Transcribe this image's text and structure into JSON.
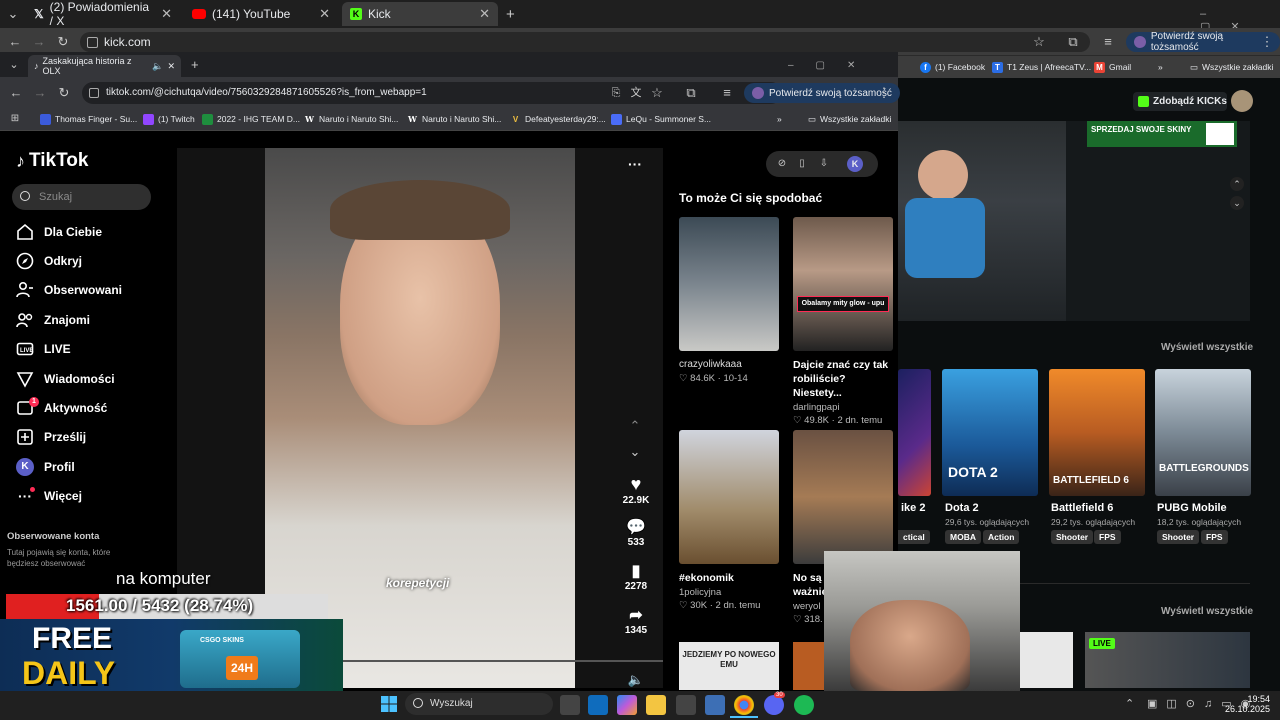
{
  "outer_browser": {
    "tabs": [
      {
        "label": "(2) Powiadomienia / X",
        "icon": "x-logo-icon"
      },
      {
        "label": "(141) YouTube",
        "icon": "youtube-icon"
      },
      {
        "label": "Kick",
        "icon": "kick-icon"
      }
    ],
    "url": "kick.com",
    "verify_label": "Potwierdź swoją tożsamość",
    "bookmarks": [
      "(1) Facebook",
      "T1 Zeus | AfreecaTV...",
      "Gmail"
    ],
    "all_bookmarks": "Wszystkie zakładki"
  },
  "inner_browser": {
    "tab_label": "Zaskakująca historia z OLX",
    "url": "tiktok.com/@cichutqa/video/7560329284871605526?is_from_webapp=1",
    "verify_label": "Potwierdź swoją tożsamość",
    "bookmarks": [
      {
        "label": "Thomas Finger - Su...",
        "color": "#3b5bdb"
      },
      {
        "label": "(1) Twitch",
        "color": "#9146ff"
      },
      {
        "label": "2022 - IHG TEAM D...",
        "color": "#1e8e3e"
      },
      {
        "label": "Naruto i Naruto Shi...",
        "icon": "W"
      },
      {
        "label": "Naruto i Naruto Shi...",
        "icon": "W"
      },
      {
        "label": "Defeatyesterday29:...",
        "icon": "V"
      },
      {
        "label": "LeQu - Summoner S...",
        "color": "#4a6cf7"
      }
    ],
    "all_bookmarks": "Wszystkie zakładki"
  },
  "tiktok": {
    "logo": "TikTok",
    "search_placeholder": "Szukaj",
    "nav": [
      "Dla Ciebie",
      "Odkryj",
      "Obserwowani",
      "Znajomi",
      "LIVE",
      "Wiadomości",
      "Aktywność",
      "Prześlij",
      "Profil",
      "Więcej"
    ],
    "activity_badge": "1",
    "profile_initial": "K",
    "followed_title": "Obserwowane konta",
    "followed_sub": "Tutaj pojawią się konta, które będziesz obserwować",
    "caption": "korepetycji",
    "likes": "22.9K",
    "comments": "533",
    "saves": "2278",
    "shares": "1345",
    "rec_title": "To może Ci się spodobać",
    "recs": [
      {
        "title": "",
        "author": "crazyoliwkaaa",
        "likes": "84.6K",
        "date": "10-14"
      },
      {
        "title": "Dajcie znać czy tak robiliście? Niestety...",
        "author": "darlingpapi",
        "likes": "49.8K",
        "date": "2 dn. temu",
        "overlay": "Obalamy mity glow - upu"
      },
      {
        "title": "#ekonomik",
        "author": "1policyjna",
        "likes": "30K",
        "date": "2 dn. temu"
      },
      {
        "title": "No są ważnie",
        "author": "weryol",
        "likes": "318.",
        "date": ""
      }
    ],
    "rec_bottom_text": "JEDZIEMY PO NOWEGO EMU"
  },
  "kick": {
    "claim_button": "Zdobądź KICKs",
    "view_all": "Wyświetl wszystkie",
    "view_all_2": "Wyświetl wszystkie",
    "banner_text": "SPRZEDAJ SWOJE SKINY",
    "games": [
      {
        "title": "ike 2",
        "viewers": "",
        "tags": [
          "ctical"
        ]
      },
      {
        "title": "Dota 2",
        "viewers": "29,6 tys. oglądających",
        "tags": [
          "MOBA",
          "Action"
        ],
        "art": "DOTA 2"
      },
      {
        "title": "Battlefield 6",
        "viewers": "29,2 tys. oglądających",
        "tags": [
          "Shooter",
          "FPS"
        ],
        "art": "BATTLEFIELD 6"
      },
      {
        "title": "PUBG Mobile",
        "viewers": "18,2 tys. oglądających",
        "tags": [
          "Shooter",
          "FPS"
        ],
        "art": "BATTLEGROUNDS"
      }
    ],
    "live_badge": "LIVE"
  },
  "stream_overlay": {
    "goal_label": "na komputer",
    "goal_progress": "1561.00 / 5432 (28.74%)",
    "goal_fraction": 0.2874,
    "ad_free": "FREE",
    "ad_daily": "DAILY",
    "ad_brand": "CSGO SKINS",
    "ad_badge": "24H"
  },
  "taskbar": {
    "search_placeholder": "Wyszukaj",
    "time": "19:54",
    "date": "26.10.2025",
    "discord_badge": "30"
  }
}
